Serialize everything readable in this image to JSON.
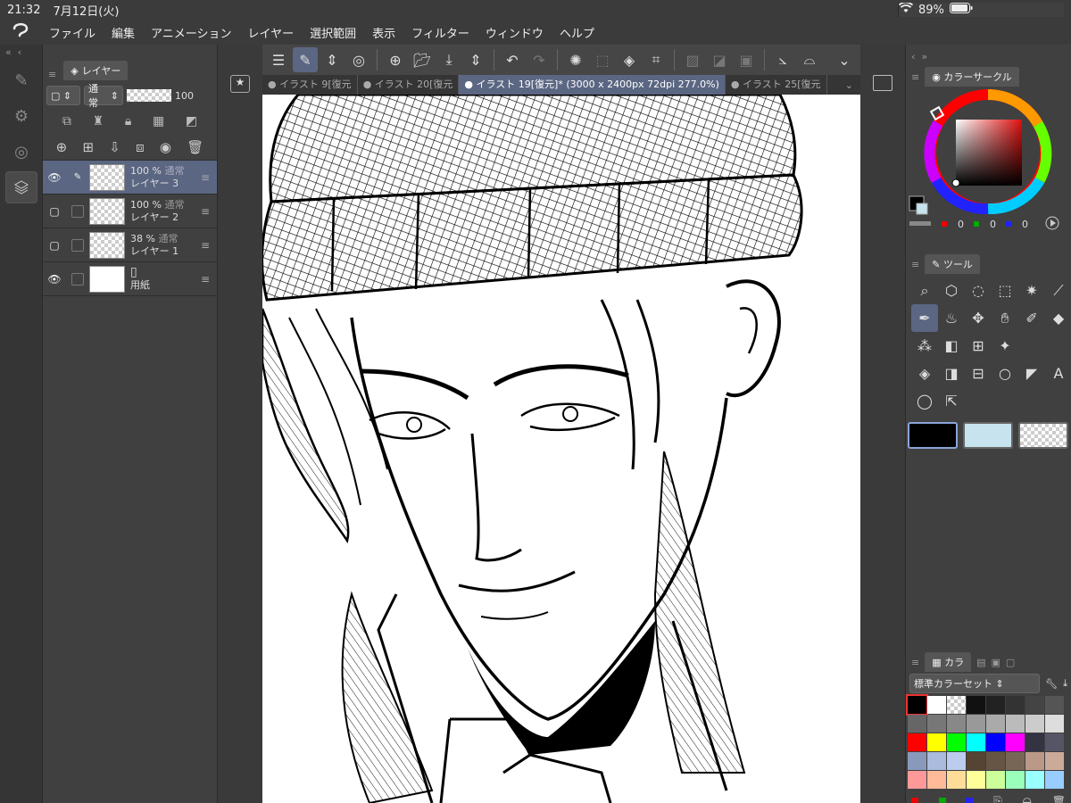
{
  "status": {
    "time": "21:32",
    "date": "7月12日(火)",
    "battery": "89%"
  },
  "menu": [
    "ファイル",
    "編集",
    "アニメーション",
    "レイヤー",
    "選択範囲",
    "表示",
    "フィルター",
    "ウィンドウ",
    "ヘルプ"
  ],
  "layer_panel": {
    "tab_label": "レイヤー",
    "blend_mode": "通常",
    "opacity": "100",
    "layers": [
      {
        "opacity": "100 %",
        "mode": "通常",
        "name": "レイヤー 3",
        "selected": true,
        "visible": true
      },
      {
        "opacity": "100 %",
        "mode": "通常",
        "name": "レイヤー 2",
        "selected": false,
        "visible": false
      },
      {
        "opacity": "38 %",
        "mode": "通常",
        "name": "レイヤー 1",
        "selected": false,
        "visible": false
      },
      {
        "opacity": "",
        "mode": "",
        "name": "用紙",
        "selected": false,
        "visible": true
      }
    ]
  },
  "doc_tabs": [
    {
      "label": "イラスト 9[復元",
      "active": false
    },
    {
      "label": "イラスト 20[復元",
      "active": false
    },
    {
      "label": "イラスト 19[復元]* (3000 x 2400px 72dpi 277.0%)",
      "active": true
    },
    {
      "label": "イラスト 25[復元",
      "active": false
    }
  ],
  "color_panel": {
    "tab_label": "カラーサークル",
    "rgb": [
      "0",
      "0",
      "0"
    ],
    "main_color": "#000000",
    "sub_color": "#c7e3ee"
  },
  "tool_panel": {
    "tab_label": "ツール"
  },
  "palette": {
    "tab_label": "カラ",
    "set_name": "標準カラーセット",
    "colors": [
      "#000000",
      "#ffffff",
      "checker",
      "#111111",
      "#222222",
      "#333333",
      "#444444",
      "#555555",
      "#666666",
      "#777777",
      "#888888",
      "#999999",
      "#aaaaaa",
      "#bbbbbb",
      "#cccccc",
      "#dddddd",
      "#ff0000",
      "#ffff00",
      "#00ff00",
      "#00ffff",
      "#0000ff",
      "#ff00ff",
      "#333344",
      "#555566",
      "#8899bb",
      "#aabbdd",
      "#bbccee",
      "#554433",
      "#665544",
      "#776655",
      "#bb9988",
      "#ccaa99",
      "#ff9999",
      "#ffbb99",
      "#ffdd99",
      "#ffff99",
      "#ccff99",
      "#99ffbb",
      "#99ffff",
      "#99ccff"
    ]
  }
}
